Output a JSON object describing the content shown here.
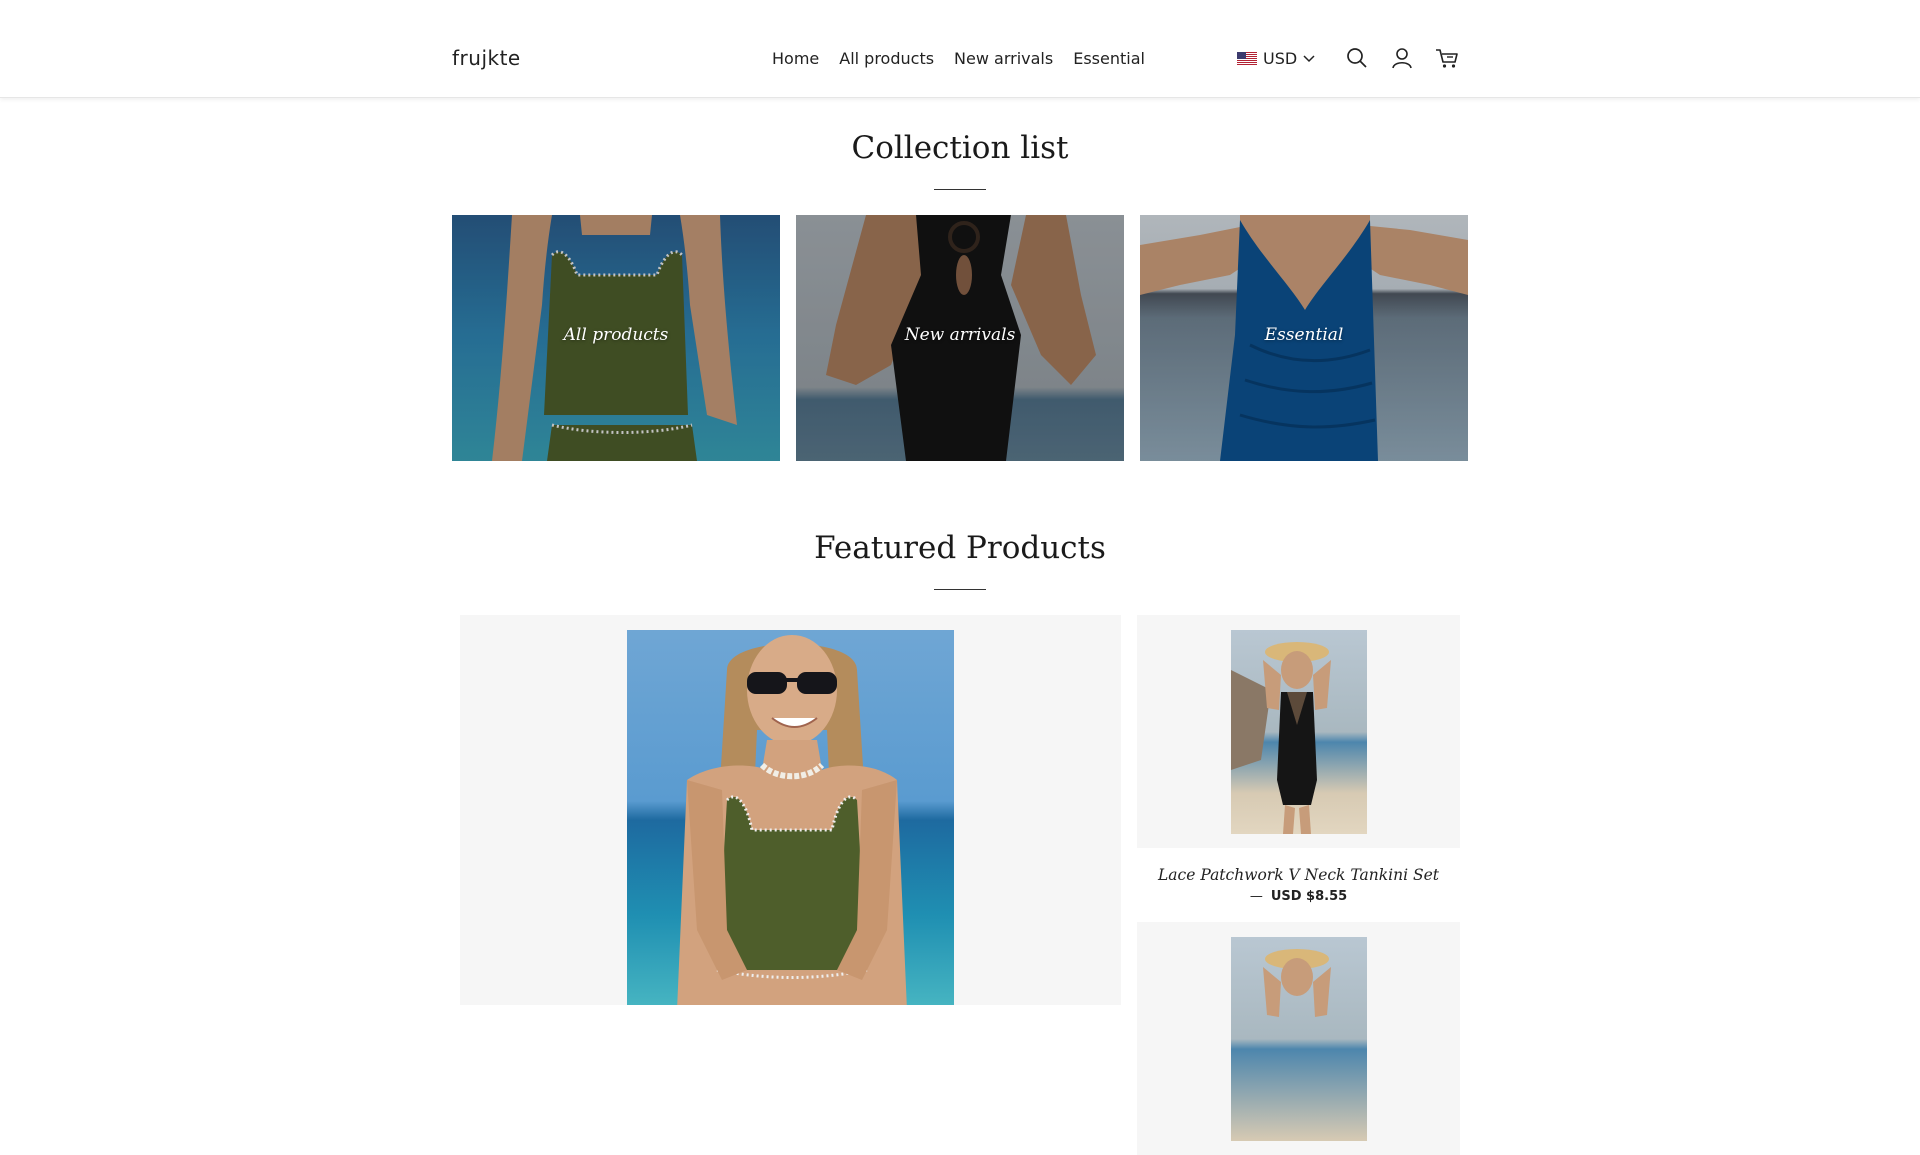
{
  "header": {
    "logo": "frujkte",
    "nav": [
      {
        "label": "Home"
      },
      {
        "label": "All products"
      },
      {
        "label": "New arrivals"
      },
      {
        "label": "Essential"
      }
    ],
    "currency": "USD",
    "icons": [
      "search-icon",
      "account-icon",
      "cart-icon"
    ]
  },
  "collection_section": {
    "title": "Collection list",
    "items": [
      {
        "label": "All products"
      },
      {
        "label": "New arrivals"
      },
      {
        "label": "Essential"
      }
    ]
  },
  "featured_section": {
    "title": "Featured Products",
    "products": [
      {
        "name": "Lace Patchwork V Neck Tankini Set",
        "price": "USD $8.55"
      }
    ]
  },
  "colors": {
    "panel_bg": "#f6f6f6",
    "text": "#222222",
    "green_swim": "#4e5e2b",
    "blue_swim": "#0c4f8c",
    "ocean": "#2f7bb0"
  }
}
